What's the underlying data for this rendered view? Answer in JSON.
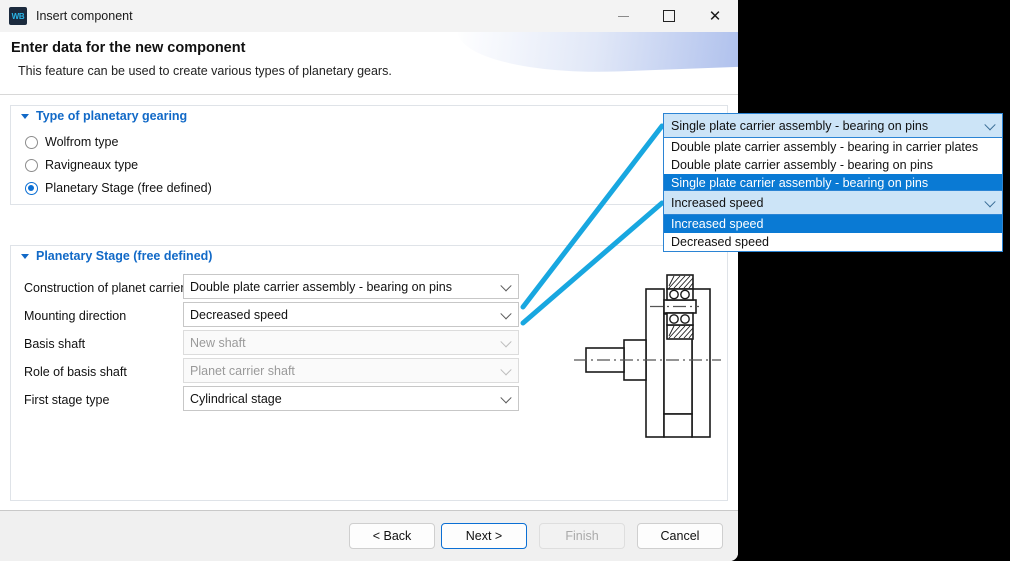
{
  "window": {
    "title": "Insert component",
    "icon_label": "WB",
    "controls": {
      "minimize": "minimize-icon",
      "maximize": "maximize-icon",
      "close": "close-icon"
    }
  },
  "header": {
    "title": "Enter data for the new component",
    "subtitle": "This feature can be used to create various types of planetary gears."
  },
  "group_type": {
    "title": "Type of planetary gearing",
    "options": [
      {
        "label": "Wolfrom type",
        "selected": false
      },
      {
        "label": "Ravigneaux type",
        "selected": false
      },
      {
        "label": "Planetary Stage (free defined)",
        "selected": true
      }
    ]
  },
  "group_stage": {
    "title": "Planetary Stage (free defined)",
    "fields": [
      {
        "label": "Construction of planet carrier",
        "value": "Double plate carrier assembly - bearing on pins",
        "disabled": false
      },
      {
        "label": "Mounting direction",
        "value": "Decreased speed",
        "disabled": false
      },
      {
        "label": "Basis shaft",
        "value": "New shaft",
        "disabled": true
      },
      {
        "label": "Role of basis shaft",
        "value": "Planet carrier shaft",
        "disabled": true
      },
      {
        "label": "First stage type",
        "value": "Cylindrical stage",
        "disabled": false
      }
    ]
  },
  "popup_carrier": {
    "current": "Single plate carrier assembly - bearing on pins",
    "options": [
      {
        "label": "Double plate carrier assembly - bearing in carrier plates",
        "selected": false
      },
      {
        "label": "Double plate carrier assembly - bearing on pins",
        "selected": false
      },
      {
        "label": "Single plate carrier assembly - bearing on pins",
        "selected": true
      }
    ]
  },
  "popup_mounting": {
    "current": "Increased speed",
    "options": [
      {
        "label": "Increased speed",
        "selected": true
      },
      {
        "label": "Decreased speed",
        "selected": false
      }
    ]
  },
  "footer": {
    "buttons": [
      {
        "label": "< Back",
        "state": "normal"
      },
      {
        "label": "Next >",
        "state": "focused"
      },
      {
        "label": "Finish",
        "state": "disabled"
      },
      {
        "label": "Cancel",
        "state": "normal"
      }
    ]
  },
  "colors": {
    "accent_blue": "#0078D7",
    "annotation_cyan": "#18A7E0",
    "group_header_blue": "#1169C7"
  }
}
